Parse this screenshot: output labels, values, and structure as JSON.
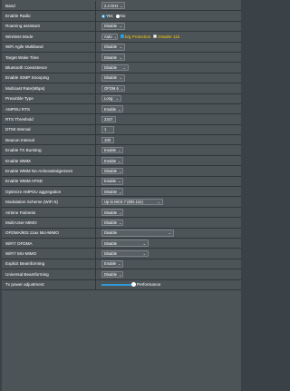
{
  "rows": [
    {
      "label": "Band",
      "type": "select",
      "value": "2.4 GHz"
    },
    {
      "label": "Enable Radio",
      "type": "radio",
      "options": [
        "Yes",
        "No"
      ],
      "selected": "Yes"
    },
    {
      "label": "Roaming assistant",
      "type": "select",
      "value": "Disable"
    },
    {
      "label": "Wireless Mode",
      "type": "mode",
      "value": "Auto",
      "check1": "b/g Protection",
      "check1_on": true,
      "check2": "Disable 11b",
      "check2_on": false
    },
    {
      "label": "WiFi Agile Multiband",
      "type": "select",
      "value": "Disable"
    },
    {
      "label": "Target Wake Time",
      "type": "select",
      "value": "Disable"
    },
    {
      "label": "Bluetooth Coexistence",
      "type": "select",
      "value": "Disable"
    },
    {
      "label": "Enable IGMP Snooping",
      "type": "select",
      "value": "Disable"
    },
    {
      "label": "Multicast Rate(Mbps)",
      "type": "select",
      "value": "OFDM 6"
    },
    {
      "label": "Preamble Type",
      "type": "select",
      "value": "Long"
    },
    {
      "label": "AMPDU RTS",
      "type": "select",
      "value": "Enable"
    },
    {
      "label": "RTS Threshold",
      "type": "text",
      "value": "2347"
    },
    {
      "label": "DTIM Interval",
      "type": "text",
      "value": "1"
    },
    {
      "label": "Beacon Interval",
      "type": "text",
      "value": "100"
    },
    {
      "label": "Enable TX Bursting",
      "type": "select",
      "value": "Enable"
    },
    {
      "label": "Enable WMM",
      "type": "select",
      "value": "Enable"
    },
    {
      "label": "Enable WMM No-Acknowledgement",
      "type": "select",
      "value": "Disable"
    },
    {
      "label": "Enable WMM APSD",
      "type": "select",
      "value": "Enable"
    },
    {
      "label": "Optimize AMPDU aggregation",
      "type": "select",
      "value": "Disable"
    },
    {
      "label": "Modulation Scheme (WiFi 5)",
      "type": "select",
      "value": "Up to MCS 7 (802.11n)"
    },
    {
      "label": "Airtime Fairness",
      "type": "select",
      "value": "Disable"
    },
    {
      "label": "Multi-User MIMO",
      "type": "select",
      "value": "Disable"
    },
    {
      "label": "OFDMA/802.11ax MU-MIMO",
      "type": "select",
      "value": "Disable"
    },
    {
      "label": "WiFi7 OFDMA",
      "type": "select",
      "value": "Disable"
    },
    {
      "label": "WiFi7 MU-MIMO",
      "type": "select",
      "value": "Disable"
    },
    {
      "label": "Explicit Beamforming",
      "type": "select",
      "value": "Enable"
    },
    {
      "label": "Universal Beamforming",
      "type": "select",
      "value": "Disable"
    },
    {
      "label": "Tx power adjustment",
      "type": "slider",
      "value": "Performance",
      "level": 1.0
    }
  ]
}
